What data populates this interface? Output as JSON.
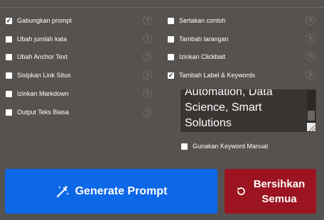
{
  "options_left": [
    {
      "label": "Gabungkan prompt",
      "checked": true,
      "help": "?"
    },
    {
      "label": "Ubah jumlah kata",
      "checked": false,
      "help": "?"
    },
    {
      "label": "Ubah Anchor Text",
      "checked": false,
      "help": "?"
    },
    {
      "label": "Sisipkan Link Situs",
      "checked": false,
      "help": "?"
    },
    {
      "label": "Izinkan Markdown",
      "checked": false,
      "help": "?"
    },
    {
      "label": "Output Teks Biasa",
      "checked": false,
      "help": "?"
    }
  ],
  "options_right": [
    {
      "label": "Sertakan contoh",
      "checked": false,
      "help": "?"
    },
    {
      "label": "Tambah larangan",
      "checked": false,
      "help": "?"
    },
    {
      "label": "Izinkan Clickbait",
      "checked": false,
      "help": "?"
    },
    {
      "label": "Tambah Label & Keywords",
      "checked": true,
      "help": "?"
    }
  ],
  "keywords_textarea": {
    "value": "Automation, Data Science, Smart Solutions"
  },
  "manual_keyword": {
    "label": "Gunakan Keyword Manual",
    "checked": false
  },
  "buttons": {
    "generate_label": "Generate Prompt",
    "clear_line1": "Bersihkan",
    "clear_line2": "Semua"
  },
  "colors": {
    "background": "#56524f",
    "generate": "#0d68e7",
    "clear": "#9c1421"
  },
  "icons": {
    "generate": "magic-wand-icon",
    "clear": "refresh-icon",
    "help": "question-icon"
  }
}
